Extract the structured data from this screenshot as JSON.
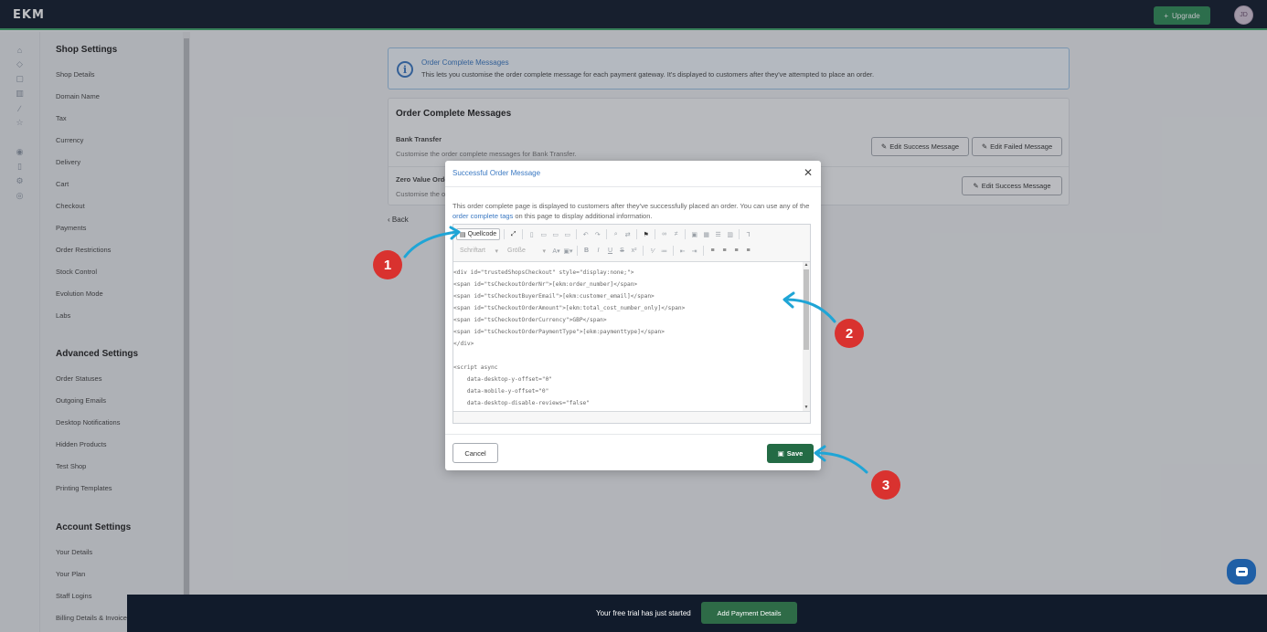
{
  "topbar": {
    "logo": "EKM",
    "upgrade_label": "Upgrade",
    "avatar_initials": "JD"
  },
  "sidebar": {
    "sections": [
      {
        "heading": "Shop Settings",
        "items": [
          "Shop Details",
          "Domain Name",
          "Tax",
          "Currency",
          "Delivery",
          "Cart",
          "Checkout",
          "Payments",
          "Order Restrictions",
          "Stock Control",
          "Evolution Mode",
          "Labs"
        ]
      },
      {
        "heading": "Advanced Settings",
        "items": [
          "Order Statuses",
          "Outgoing Emails",
          "Desktop Notifications",
          "Hidden Products",
          "Test Shop",
          "Printing Templates"
        ]
      },
      {
        "heading": "Account Settings",
        "items": [
          "Your Details",
          "Your Plan",
          "Staff Logins",
          "Billing Details & Invoices"
        ]
      }
    ]
  },
  "info": {
    "title": "Order Complete Messages",
    "text": "This lets you customise the order complete message for each payment gateway. It's displayed to customers after they've attempted to place an order."
  },
  "panel": {
    "title": "Order Complete Messages",
    "rows": [
      {
        "label": "Bank Transfer",
        "desc": "Customise the order complete messages for Bank Transfer.",
        "buttons": [
          "Edit Success Message",
          "Edit Failed Message"
        ]
      },
      {
        "label": "Zero Value Orders",
        "desc": "Customise the order complete messages for Zero Value Orders.",
        "buttons": [
          "Edit Success Message"
        ]
      }
    ]
  },
  "back_label": "Back",
  "modal": {
    "title": "Successful Order Message",
    "desc_before": "This order complete page is displayed to customers after they've successfully placed an order. You can use any of the ",
    "desc_link": "order complete tags",
    "desc_after": " on this page to display additional information.",
    "toolbar": {
      "source_label": "Quellcode",
      "font_select": "Schriftart",
      "size_select": "Größe"
    },
    "code_lines": [
      "<div id=\"trustedShopsCheckout\" style=\"display:none;\">",
      "<span id=\"tsCheckoutOrderNr\">[ekm:order_number]</span>",
      "<span id=\"tsCheckoutBuyerEmail\">[ekm:customer_email]</span>",
      "<span id=\"tsCheckoutOrderAmount\">[ekm:total_cost_number_only]</span>",
      "<span id=\"tsCheckoutOrderCurrency\">GBP</span>",
      "<span id=\"tsCheckoutOrderPaymentType\">[ekm:paymenttype]</span>",
      "</div>",
      "",
      "<script async",
      "    data-desktop-y-offset=\"0\"",
      "    data-mobile-y-offset=\"0\"",
      "    data-desktop-disable-reviews=\"false\""
    ],
    "cancel_label": "Cancel",
    "save_label": "Save"
  },
  "annotations": [
    "1",
    "2",
    "3"
  ],
  "trial": {
    "text": "Your free trial has just started",
    "button": "Add Payment Details"
  },
  "colors": {
    "topbar": "#111b2b",
    "accent_green": "#2e8b57",
    "save_green": "#236b45",
    "link_blue": "#3a78c2",
    "annotation_red": "#d9322f",
    "arrow_blue": "#1fa5d6"
  }
}
